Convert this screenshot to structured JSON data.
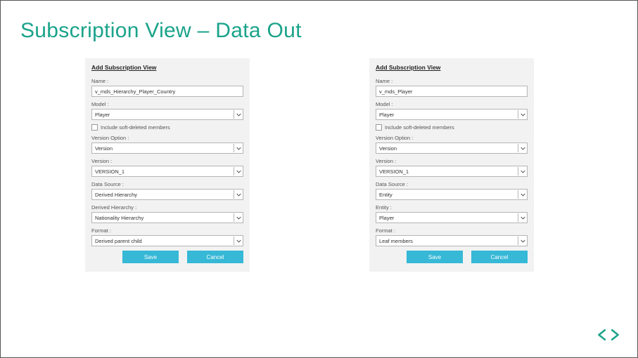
{
  "title": "Subscription View – Data Out",
  "panels": [
    {
      "heading": "Add Subscription View",
      "labels": {
        "name": "Name :",
        "model": "Model :",
        "include_soft_deleted": "Include soft-deleted members",
        "version_option": "Version Option :",
        "version": "Version :",
        "data_source": "Data Source :",
        "derived_hierarchy": "Derived Hierarchy :",
        "format": "Format :"
      },
      "values": {
        "name": "v_mds_Hierarchy_Player_Country",
        "model": "Player",
        "version_option": "Version",
        "version": "VERSION_1",
        "data_source": "Derived Hierarchy",
        "derived_hierarchy": "Nationality Hierarchy",
        "format": "Derived parent child"
      },
      "buttons": {
        "save": "Save",
        "cancel": "Cancel"
      }
    },
    {
      "heading": "Add Subscription View",
      "labels": {
        "name": "Name :",
        "model": "Model :",
        "include_soft_deleted": "Include soft-deleted members",
        "version_option": "Version Option :",
        "version": "Version :",
        "data_source": "Data Source :",
        "entity": "Entity :",
        "format": "Format :"
      },
      "values": {
        "name": "v_mds_Player",
        "model": "Player",
        "version_option": "Version",
        "version": "VERSION_1",
        "data_source": "Entity",
        "entity": "Player",
        "format": "Leaf members"
      },
      "buttons": {
        "save": "Save",
        "cancel": "Cancel"
      }
    }
  ],
  "colors": {
    "accent_title": "#1aa38a",
    "button": "#36b8d6"
  }
}
